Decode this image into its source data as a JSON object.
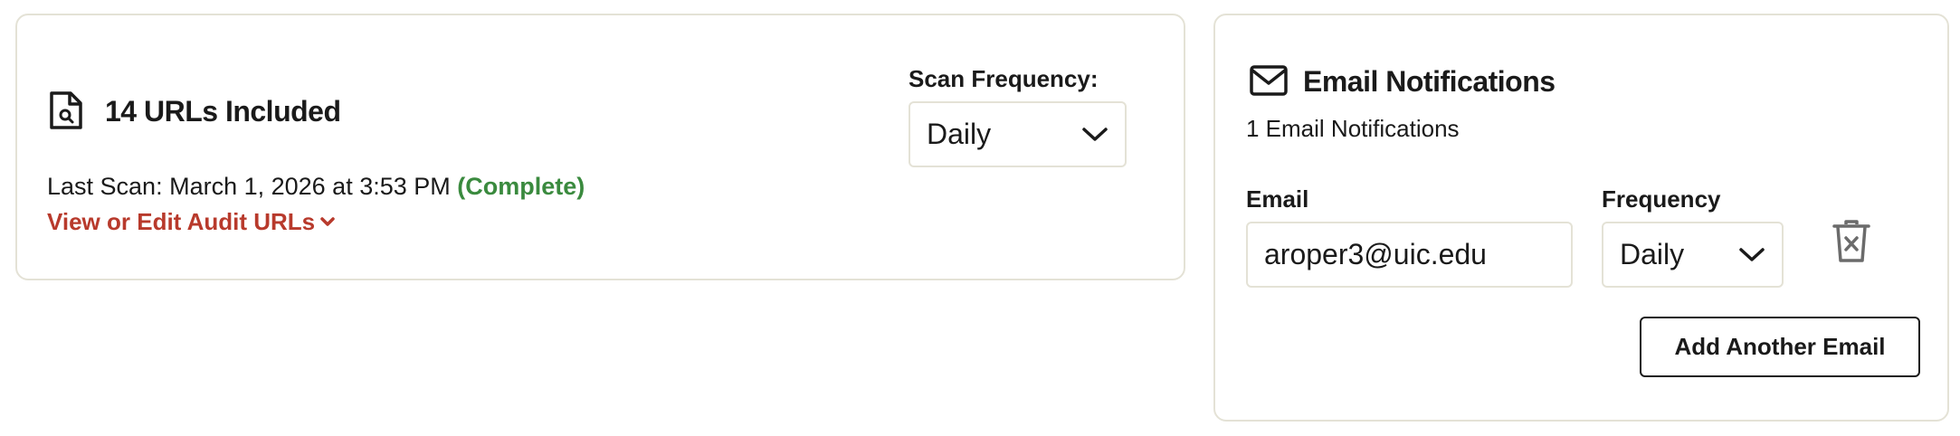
{
  "audit": {
    "title": "14 URLs Included",
    "last_scan_prefix": "Last Scan: March 1, 2026 at 3:53 PM ",
    "last_scan_status": "(Complete)",
    "view_edit_label": "View or Edit Audit URLs",
    "scan_frequency_label": "Scan Frequency:",
    "scan_frequency_value": "Daily"
  },
  "notifications": {
    "title": "Email Notifications",
    "count_text": "1 Email Notifications",
    "email_label": "Email",
    "frequency_label": "Frequency",
    "email_value": "aroper3@uic.edu",
    "frequency_value": "Daily",
    "add_button_label": "Add Another Email"
  },
  "icons": {
    "document": "document-search-icon",
    "mail": "mail-icon",
    "chevron": "chevron-down-icon",
    "trash": "trash-icon"
  },
  "colors": {
    "status_complete": "#3a8a3e",
    "link": "#b83a2c",
    "card_border": "#e4e2d6"
  }
}
